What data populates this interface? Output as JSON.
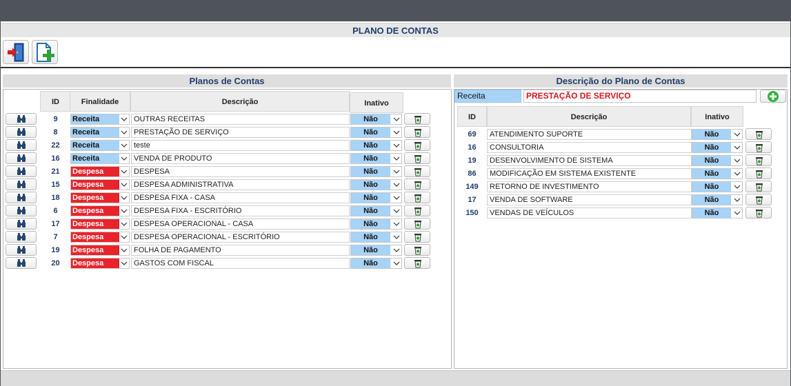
{
  "page": {
    "title": "PLANO DE CONTAS"
  },
  "colors": {
    "receita": "#a7d3f7",
    "despesa": "#e9232a",
    "nao": "#a7d3f7",
    "title_text": "#1f3d6b",
    "tipo_desc_text": "#d6191f"
  },
  "toolbar": {
    "icons": [
      "exit-door-icon",
      "new-document-icon"
    ]
  },
  "left": {
    "title": "Planos de Contas",
    "headers": {
      "id": "ID",
      "finalidade": "Finalidade",
      "descricao": "Descrição",
      "inativo": "Inativo"
    },
    "rows": [
      {
        "id": "9",
        "finalidade": "Receita",
        "descricao": "OUTRAS RECEITAS",
        "inativo": "Não"
      },
      {
        "id": "8",
        "finalidade": "Receita",
        "descricao": "PRESTAÇÃO DE SERVIÇO",
        "inativo": "Não"
      },
      {
        "id": "22",
        "finalidade": "Receita",
        "descricao": "teste",
        "inativo": "Não"
      },
      {
        "id": "16",
        "finalidade": "Receita",
        "descricao": "VENDA DE PRODUTO",
        "inativo": "Não"
      },
      {
        "id": "21",
        "finalidade": "Despesa",
        "descricao": "DESPESA",
        "inativo": "Não"
      },
      {
        "id": "15",
        "finalidade": "Despesa",
        "descricao": "DESPESA ADMINISTRATIVA",
        "inativo": "Não"
      },
      {
        "id": "18",
        "finalidade": "Despesa",
        "descricao": "DESPESA FIXA - CASA",
        "inativo": "Não"
      },
      {
        "id": "6",
        "finalidade": "Despesa",
        "descricao": "DESPESA FIXA - ESCRITÓRIO",
        "inativo": "Não"
      },
      {
        "id": "17",
        "finalidade": "Despesa",
        "descricao": "DESPESA OPERACIONAL - CASA",
        "inativo": "Não"
      },
      {
        "id": "7",
        "finalidade": "Despesa",
        "descricao": "DESPESA OPERACIONAL - ESCRITÓRIO",
        "inativo": "Não"
      },
      {
        "id": "19",
        "finalidade": "Despesa",
        "descricao": "FOLHA DE PAGAMENTO",
        "inativo": "Não"
      },
      {
        "id": "20",
        "finalidade": "Despesa",
        "descricao": "GASTOS COM FISCAL",
        "inativo": "Não"
      }
    ]
  },
  "right": {
    "title": "Descrição do Plano de Contas",
    "tipo": "Receita",
    "plano_descricao": "PRESTAÇÃO DE SERVIÇO",
    "headers": {
      "id": "ID",
      "descricao": "Descrição",
      "inativo": "Inativo"
    },
    "rows": [
      {
        "id": "69",
        "descricao": "ATENDIMENTO SUPORTE",
        "inativo": "Não"
      },
      {
        "id": "16",
        "descricao": "CONSULTORIA",
        "inativo": "Não"
      },
      {
        "id": "19",
        "descricao": "DESENVOLVIMENTO DE SISTEMA",
        "inativo": "Não"
      },
      {
        "id": "86",
        "descricao": "MODIFICAÇÃO EM SISTEMA EXISTENTE",
        "inativo": "Não"
      },
      {
        "id": "149",
        "descricao": "RETORNO DE INVESTIMENTO",
        "inativo": "Não"
      },
      {
        "id": "17",
        "descricao": "VENDA DE SOFTWARE",
        "inativo": "Não"
      },
      {
        "id": "150",
        "descricao": "VENDAS DE VEÍCULOS",
        "inativo": "Não"
      }
    ]
  }
}
